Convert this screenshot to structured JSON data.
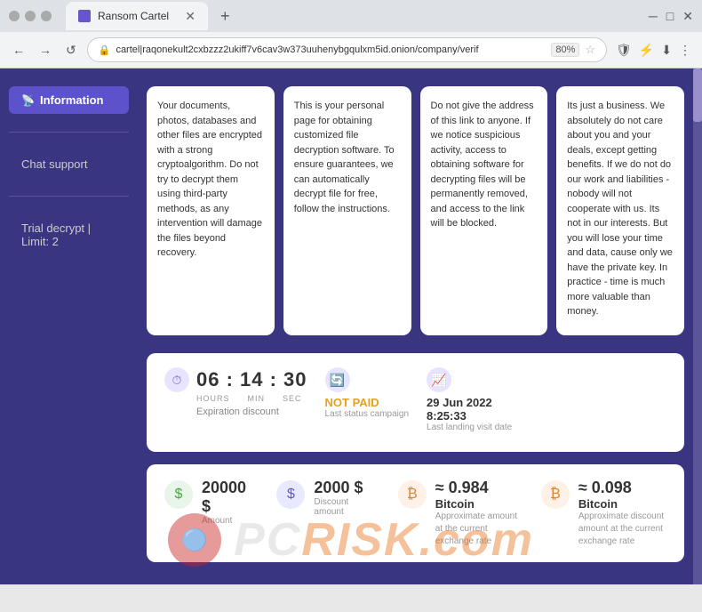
{
  "browser": {
    "tab_title": "Ransom Cartel",
    "url": "cartel|raqonekult2cxbzzz2ukiff7v6cav3w373uuhenybgqulxm5id.onion/company/verif",
    "zoom": "80%",
    "new_tab_label": "+",
    "nav": {
      "back": "←",
      "forward": "→",
      "refresh": "↺"
    }
  },
  "sidebar": {
    "items": [
      {
        "id": "information",
        "label": "Information",
        "active": true
      },
      {
        "id": "chat-support",
        "label": "Chat support",
        "active": false
      },
      {
        "id": "trial-decrypt",
        "label": "Trial decrypt | Limit: 2",
        "active": false
      }
    ]
  },
  "cards": [
    {
      "text": "Your documents, photos, databases and other files are encrypted with a strong cryptoalgorithm. Do not try to decrypt them using third-party methods, as any intervention will damage the files beyond recovery."
    },
    {
      "text": "This is your personal page for obtaining customized file decryption software. To ensure guarantees, we can automatically decrypt file for free, follow the instructions."
    },
    {
      "text": "Do not give the address of this link to anyone. If we notice suspicious activity, access to obtaining software for decrypting files will be permanently removed, and access to the link will be blocked."
    },
    {
      "text": "Its just a business. We absolutely do not care about you and your deals, except getting benefits. If we do not do our work and liabilities - nobody will not cooperate with us. Its not in our interests. But you will lose your time and data, cause only we have the private key. In practice - time is much more valuable than money."
    }
  ],
  "status": {
    "timer": {
      "value": "06 : 14 : 30",
      "hours_label": "HOURS",
      "min_label": "MIN",
      "sec_label": "SEC"
    },
    "payment_status": "NOT PAID",
    "payment_sub": "Last status campaign",
    "date_value": "29 Jun 2022\n8:25:33",
    "date_sub": "Last landing visit date",
    "expiration_label": "Expiration discount"
  },
  "amounts": [
    {
      "icon": "$",
      "icon_style": "green",
      "value": "20000 $",
      "label": "Amount"
    },
    {
      "icon": "$",
      "icon_style": "blue",
      "value": "2000 $",
      "label": "Discount amount"
    },
    {
      "icon": "₿",
      "icon_style": "orange",
      "value": "≈ 0.984",
      "unit": "Bitcoin",
      "desc": "Approximate amount at the current exchange rate"
    },
    {
      "icon": "₿",
      "icon_style": "orange",
      "value": "≈ 0.098",
      "unit": "Bitcoin",
      "desc": "Approximate discount amount at the current exchange rate"
    }
  ],
  "watermark": {
    "text_main": "PC",
    "text_brand": "RISK",
    "text_suffix": ".com"
  }
}
